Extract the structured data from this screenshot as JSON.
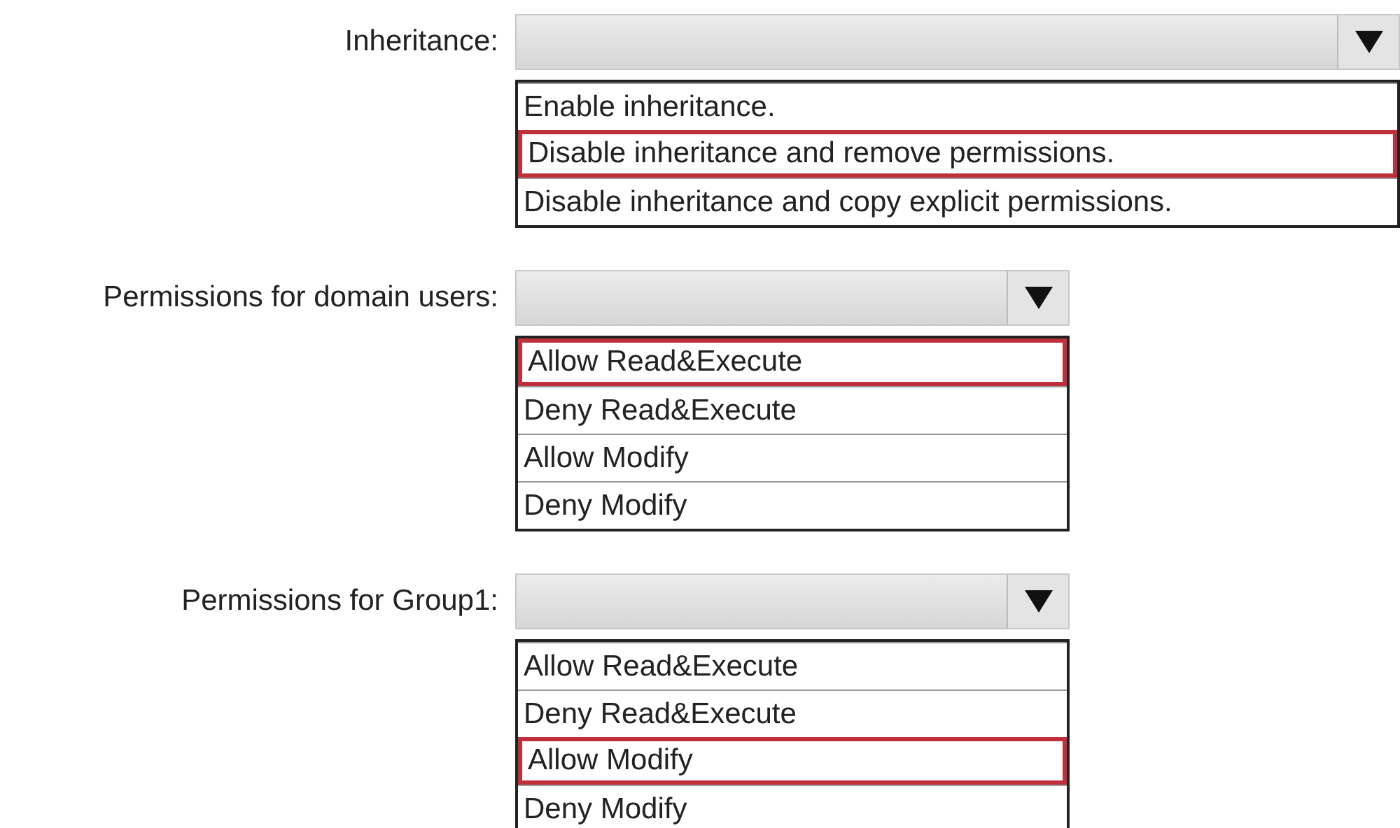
{
  "questions": [
    {
      "label": "Inheritance:",
      "options": [
        {
          "text": "Enable inheritance.",
          "selected": false
        },
        {
          "text": "Disable inheritance and remove permissions.",
          "selected": true
        },
        {
          "text": "Disable inheritance and copy explicit permissions.",
          "selected": false
        }
      ]
    },
    {
      "label": "Permissions for domain users:",
      "options": [
        {
          "text": "Allow Read&Execute",
          "selected": true
        },
        {
          "text": "Deny Read&Execute",
          "selected": false
        },
        {
          "text": "Allow Modify",
          "selected": false
        },
        {
          "text": "Deny Modify",
          "selected": false
        }
      ]
    },
    {
      "label": "Permissions for Group1:",
      "options": [
        {
          "text": "Allow Read&Execute",
          "selected": false
        },
        {
          "text": "Deny Read&Execute",
          "selected": false
        },
        {
          "text": "Allow Modify",
          "selected": true
        },
        {
          "text": "Deny Modify",
          "selected": false
        }
      ]
    }
  ]
}
